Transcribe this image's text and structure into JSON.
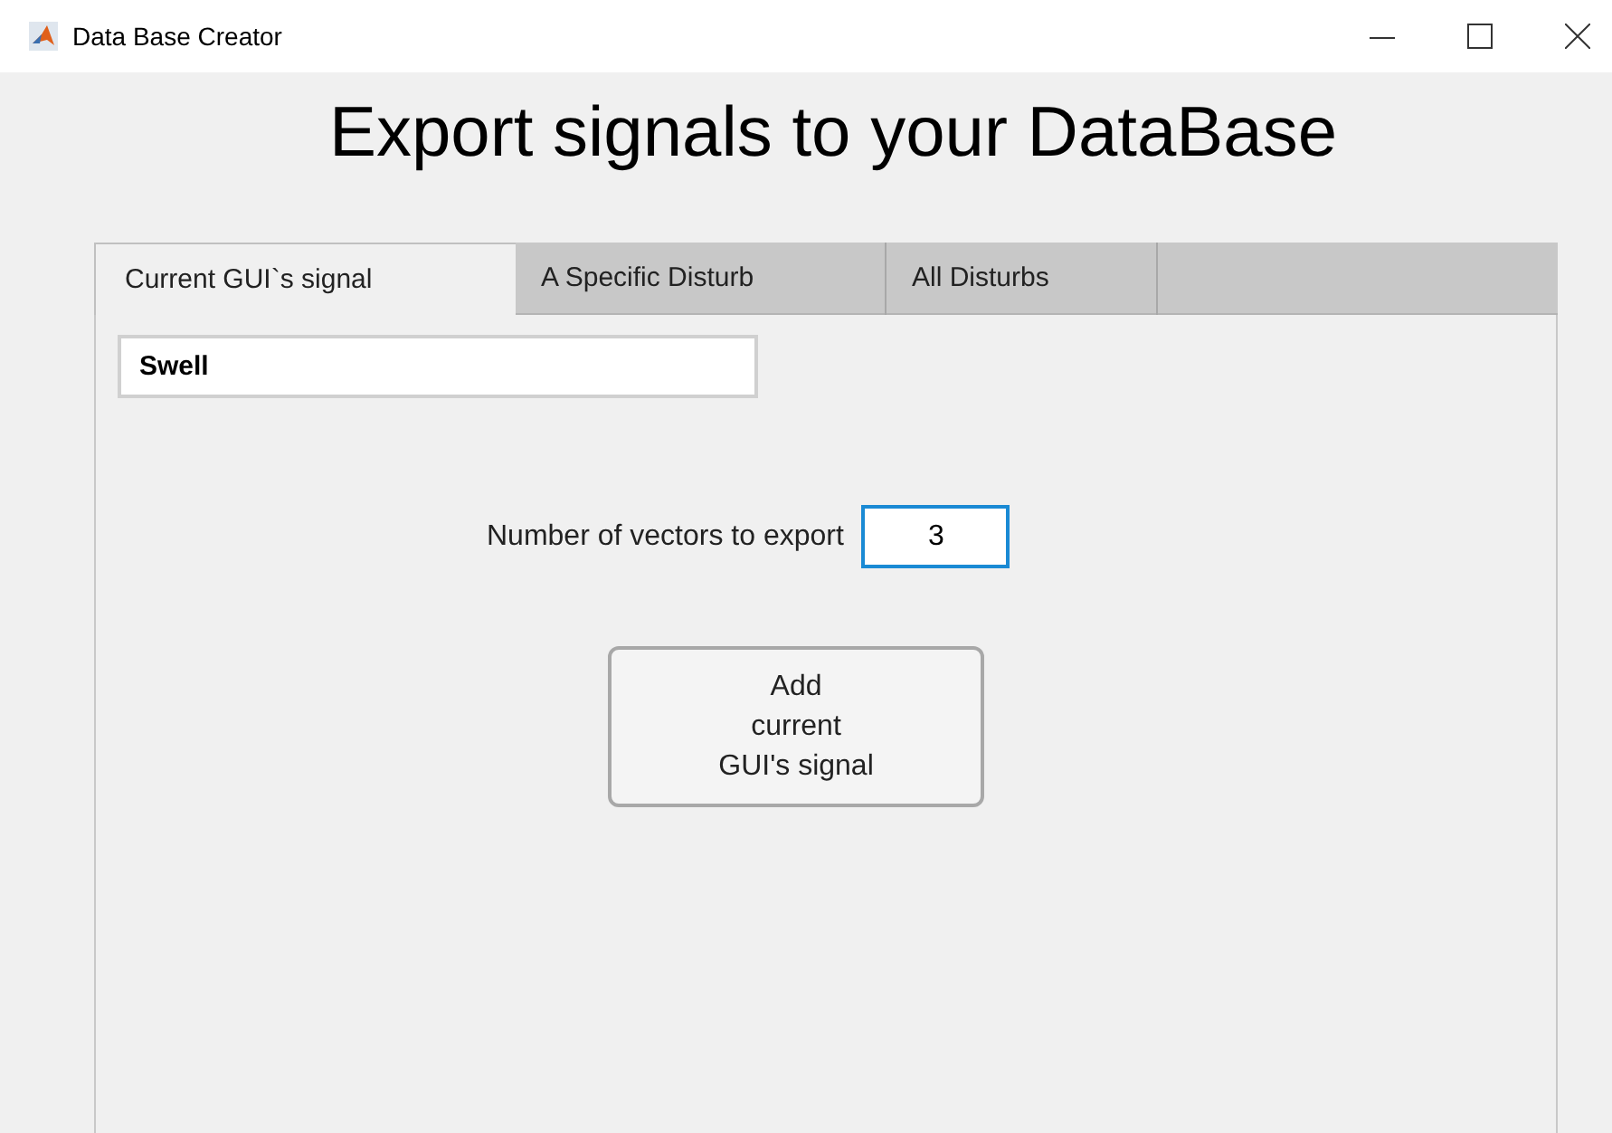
{
  "window": {
    "title": "Data Base Creator"
  },
  "heading": "Export signals to your DataBase",
  "tabs": [
    {
      "label": "Current GUI`s signal",
      "selected": true
    },
    {
      "label": "A Specific Disturb",
      "selected": false
    },
    {
      "label": "All Disturbs",
      "selected": false
    }
  ],
  "signal_field": {
    "value": "Swell"
  },
  "vectors": {
    "label": "Number of vectors to export",
    "value": "3"
  },
  "add_button": "Add\ncurrent\nGUI's signal"
}
